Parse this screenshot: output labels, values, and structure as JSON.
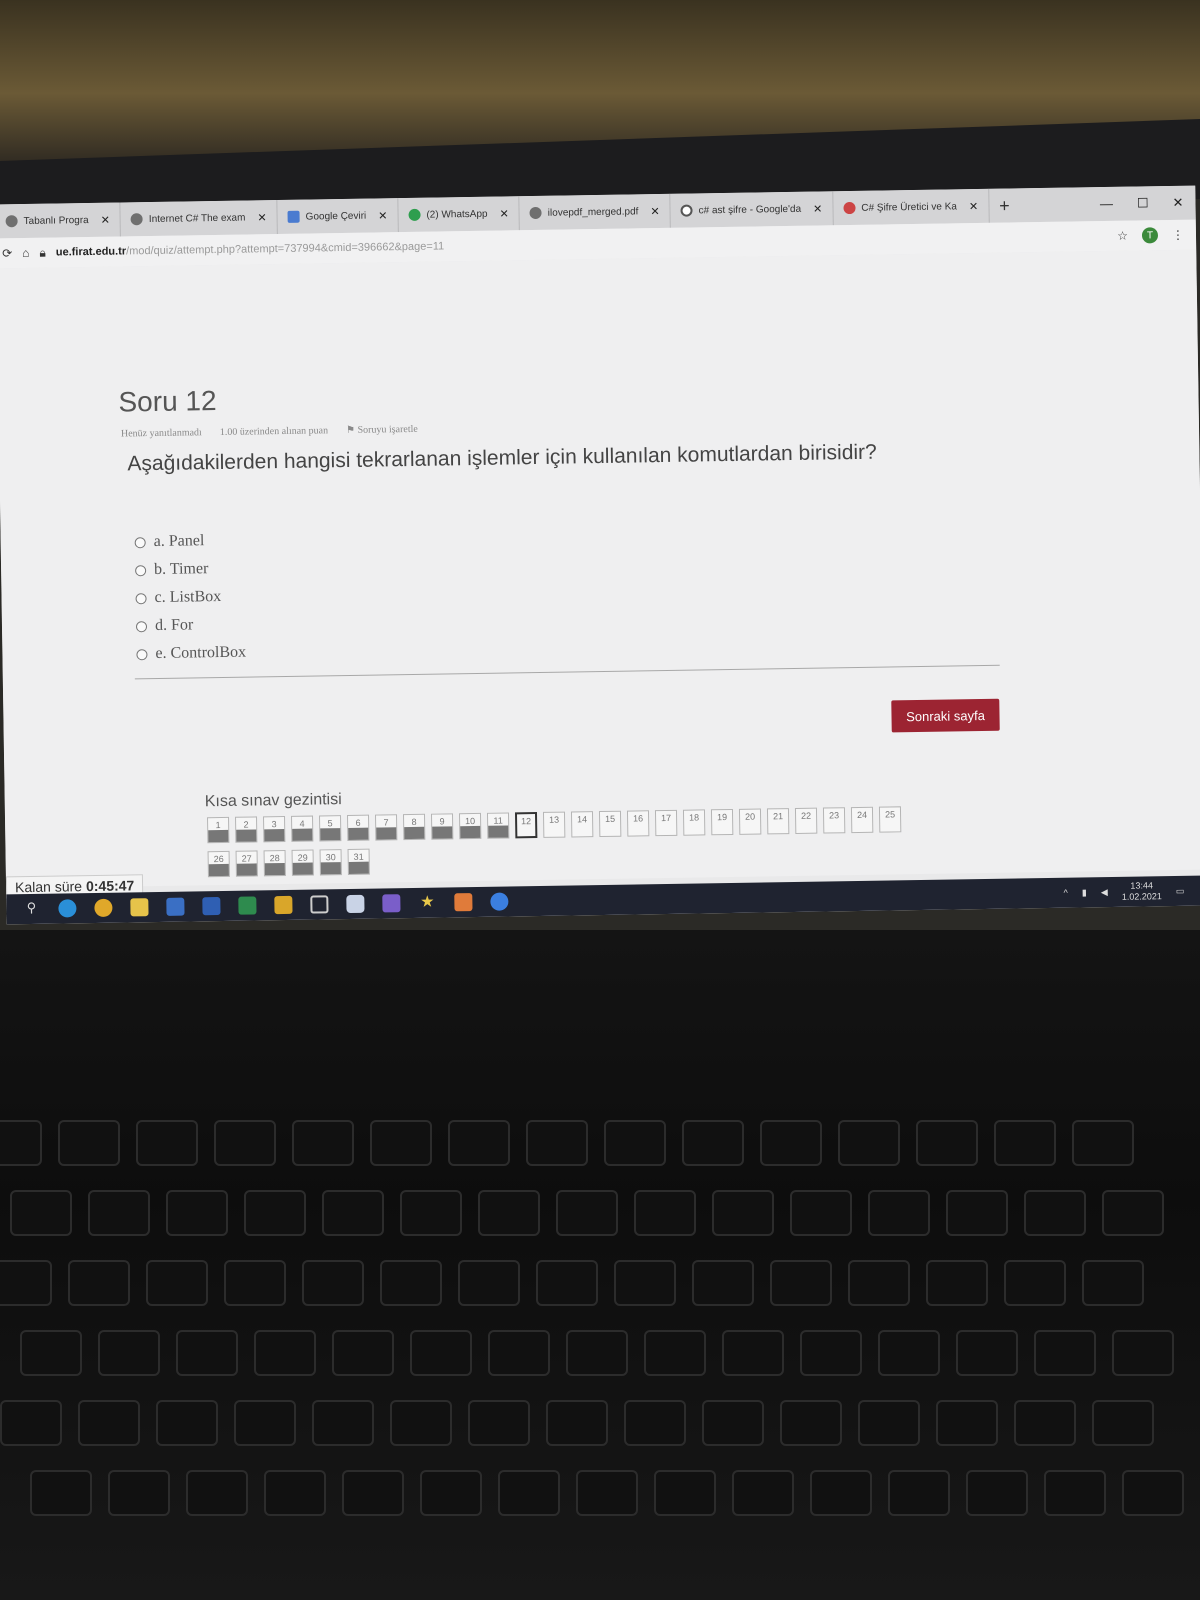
{
  "browser": {
    "tabs": [
      {
        "label": "Tabanlı Progra",
        "icon": "page-icon"
      },
      {
        "label": "Internet C# The exam",
        "icon": "page-icon"
      },
      {
        "label": "Google Çeviri",
        "icon": "translate-icon"
      },
      {
        "label": "(2) WhatsApp",
        "icon": "whatsapp-icon"
      },
      {
        "label": "ilovepdf_merged.pdf",
        "icon": "page-icon"
      },
      {
        "label": "c# ast şifre - Google'da",
        "icon": "google-icon"
      },
      {
        "label": "C# Şifre Üretici ve Ka",
        "icon": "page-icon"
      }
    ],
    "new_tab_label": "+",
    "url_domain": "ue.firat.edu.tr",
    "url_rest": "/mod/quiz/attempt.php?attempt=737994&cmid=396662&page=11"
  },
  "question": {
    "title": "Soru 12",
    "status": "Henüz yanıtlanmadı",
    "points": "1.00 üzerinden alınan puan",
    "flag_label": "Soruyu işaretle",
    "text": "Aşağıdakilerden hangisi tekrarlanan işlemler için kullanılan komutlardan birisidir?",
    "options": [
      "a. Panel",
      "b. Timer",
      "c. ListBox",
      "d. For",
      "e. ControlBox"
    ]
  },
  "next_button_label": "Sonraki sayfa",
  "quiz_nav": {
    "title": "Kısa sınav gezintisi",
    "row1": [
      "1",
      "2",
      "3",
      "4",
      "5",
      "6",
      "7",
      "8",
      "9",
      "10",
      "11",
      "12",
      "13",
      "14",
      "15",
      "16",
      "17",
      "18",
      "19",
      "20",
      "21",
      "22",
      "23",
      "24",
      "25"
    ],
    "row2": [
      "26",
      "27",
      "28",
      "29",
      "30",
      "31"
    ],
    "answered": [
      "1",
      "2",
      "3",
      "4",
      "5",
      "6",
      "7",
      "8",
      "9",
      "10",
      "11",
      "26",
      "27",
      "28",
      "29",
      "30",
      "31"
    ],
    "current": "12",
    "flagged": "8"
  },
  "timer": {
    "label": "Kalan süre",
    "value": "0:45:47"
  },
  "taskbar": {
    "clock_time": "13:44",
    "clock_date": "1.02.2021",
    "icons": [
      "search-icon",
      "edge-icon",
      "chrome-icon",
      "file-explorer-icon",
      "store-icon",
      "word-icon",
      "excel-icon",
      "powerpoint-icon",
      "window-icon",
      "cube-icon",
      "visual-studio-icon",
      "star-icon",
      "paint-icon",
      "zoom-icon"
    ]
  }
}
